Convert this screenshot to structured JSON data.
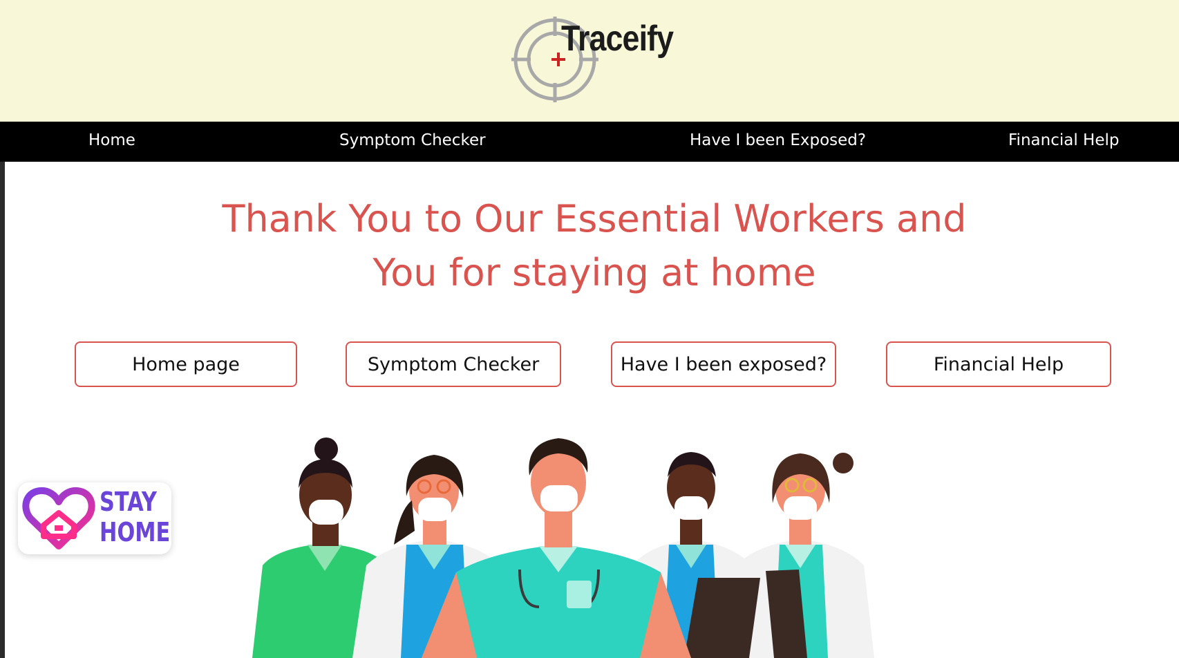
{
  "header": {
    "brand": "Traceify"
  },
  "nav": {
    "items": [
      {
        "label": "Home"
      },
      {
        "label": "Symptom Checker"
      },
      {
        "label": "Have I been Exposed?"
      },
      {
        "label": "Financial Help"
      }
    ]
  },
  "main": {
    "headline_line1": "Thank You to Our Essential Workers and",
    "headline_line2": "You for staying at home",
    "buttons": [
      {
        "label": "Home page"
      },
      {
        "label": "Symptom Checker"
      },
      {
        "label": "Have I been exposed?"
      },
      {
        "label": "Financial Help"
      }
    ]
  },
  "badge": {
    "line1": "STAY",
    "line2": "HOME"
  },
  "colors": {
    "header_bg": "#f8f8d8",
    "nav_bg": "#000000",
    "accent": "#d9534f",
    "badge_purple": "#6a45d8"
  },
  "icons": {
    "logo": "crosshair-logo-icon",
    "badge": "heart-house-icon",
    "illustration": "healthcare-workers-illustration"
  }
}
